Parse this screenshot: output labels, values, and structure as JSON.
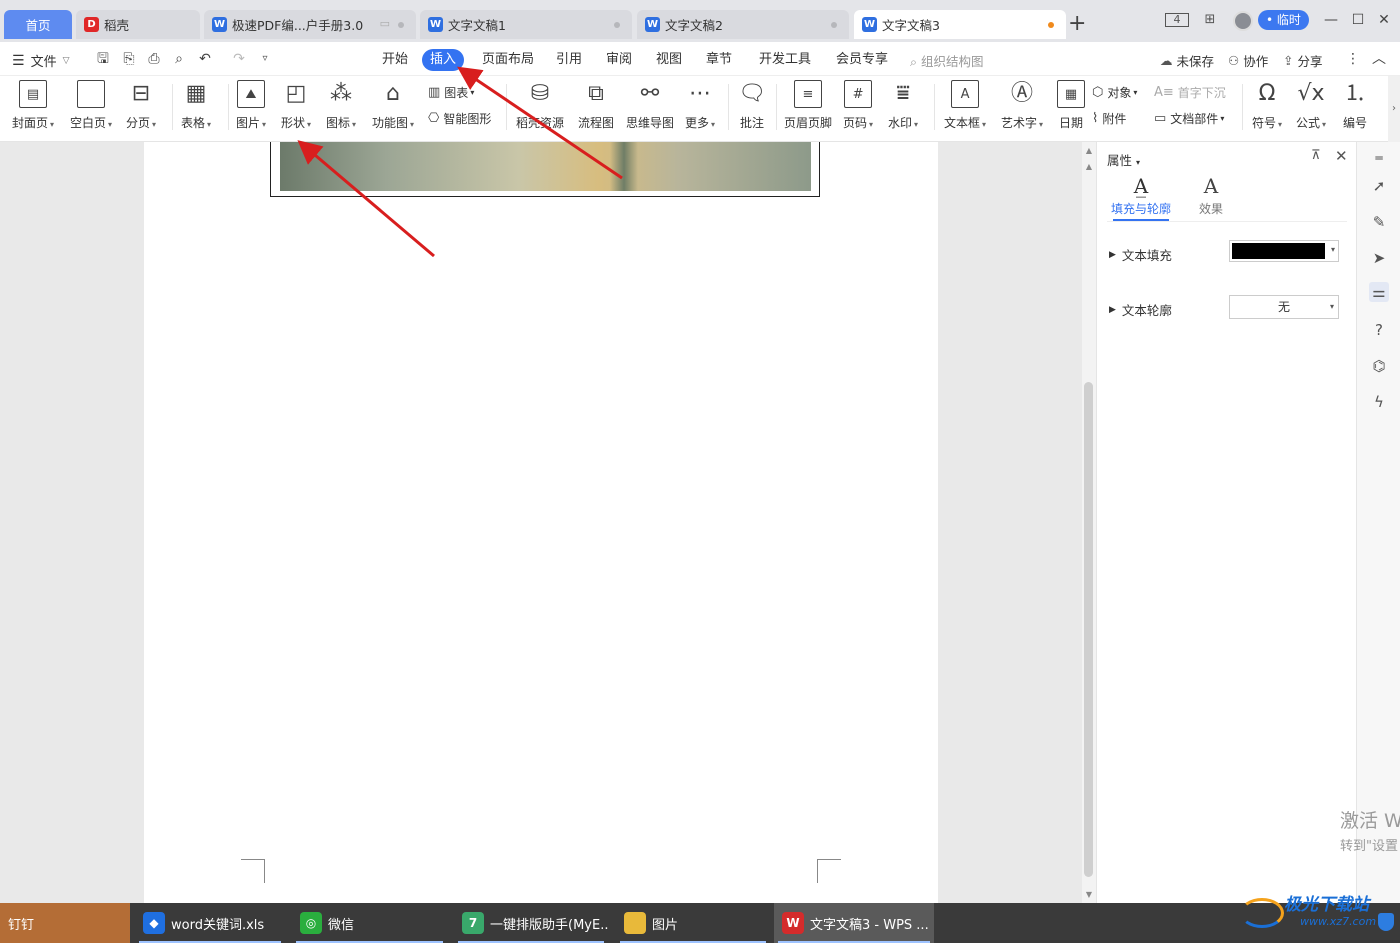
{
  "tabs": [
    {
      "label": "首页",
      "icon": "",
      "icon_name": ""
    },
    {
      "label": "稻壳",
      "icon": "D",
      "icon_name": "docer-icon"
    },
    {
      "label": "极速PDF编...户手册3.0",
      "icon": "W",
      "icon_name": "wps-writer-icon"
    },
    {
      "label": "文字文稿1",
      "icon": "W",
      "icon_name": "wps-writer-icon"
    },
    {
      "label": "文字文稿2",
      "icon": "W",
      "icon_name": "wps-writer-icon"
    },
    {
      "label": "文字文稿3",
      "icon": "W",
      "icon_name": "wps-writer-icon"
    }
  ],
  "titlebar": {
    "badge_label": "• 临时"
  },
  "menu": {
    "file_label": "文件",
    "tabs": [
      "开始",
      "插入",
      "页面布局",
      "引用",
      "审阅",
      "视图",
      "章节",
      "开发工具",
      "会员专享"
    ],
    "active_tab": "插入",
    "search_placeholder": "组织结构图",
    "unsaved": "未保存",
    "collab": "协作",
    "share": "分享"
  },
  "toolbar": {
    "cover": "封面页",
    "blank": "空白页",
    "pagebreak": "分页",
    "table": "表格",
    "picture": "图片",
    "shape": "形状",
    "icons": "图标",
    "funcchart": "功能图",
    "chart": "图表",
    "smartart": "智能图形",
    "docer_res": "稻壳资源",
    "flowchart": "流程图",
    "mindmap": "思维导图",
    "more": "更多",
    "comment": "批注",
    "headerfooter": "页眉页脚",
    "pagenum": "页码",
    "watermark": "水印",
    "textbox": "文本框",
    "wordart": "艺术字",
    "date": "日期",
    "object": "对象",
    "dropcap": "首字下沉",
    "attachment": "附件",
    "docparts": "文档部件",
    "symbol": "符号",
    "formula": "公式",
    "numbering": "编号"
  },
  "pane": {
    "title": "属性",
    "tab_fill": "填充与轮廓",
    "tab_effect": "效果",
    "text_fill": "文本填充",
    "text_fill_color": "#000000",
    "text_outline": "文本轮廓",
    "text_outline_value": "无"
  },
  "activation": {
    "line1": "激活 W",
    "line2": "转到\"设置"
  },
  "taskbar": [
    {
      "label": "钉钉"
    },
    {
      "label": "word关键词.xls"
    },
    {
      "label": "微信"
    },
    {
      "label": "一键排版助手(MyE..."
    },
    {
      "label": "图片"
    },
    {
      "label": "文字文稿3 - WPS ..."
    }
  ],
  "brand": {
    "name": "极光下载站",
    "url": "www.xz7.com"
  },
  "colors": {
    "accent": "#3473f1",
    "home_tab": "#5e8bf0",
    "annotation_arrow": "#d81e1e",
    "unsaved_dot": "#f08a1c"
  }
}
